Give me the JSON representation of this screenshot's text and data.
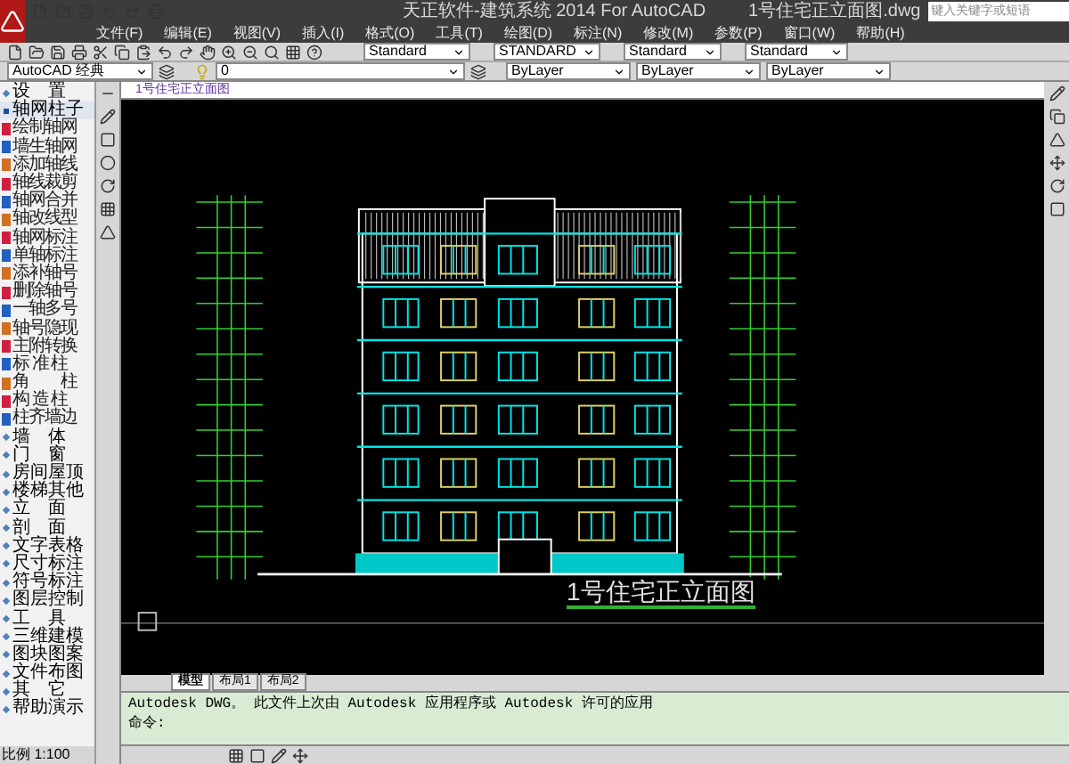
{
  "app": {
    "title": "天正软件-建筑系统 2014  For AutoCAD",
    "file_name": "1号住宅正立面图.dwg",
    "search": {
      "placeholder": "键入关键字或短语"
    }
  },
  "menu": [
    "文件(F)",
    "编辑(E)",
    "视图(V)",
    "插入(I)",
    "格式(O)",
    "工具(T)",
    "绘图(D)",
    "标注(N)",
    "修改(M)",
    "参数(P)",
    "窗口(W)",
    "帮助(H)"
  ],
  "toolbar": {
    "text_style": "Standard",
    "dim_style": "STANDARD",
    "table_style": "Standard",
    "multileader_style": "Standard",
    "workspace": "AutoCAD 经典",
    "layer": "0",
    "color_control": "ByLayer",
    "linetype": "ByLayer",
    "lineweight": "ByLayer"
  },
  "panel": {
    "sections": [
      {
        "label": "设　置",
        "expanded": false
      },
      {
        "label": "轴网柱子",
        "expanded": true,
        "children": [
          "绘制轴网",
          "墙生轴网",
          "添加轴线",
          "轴线裁剪",
          "轴网合并",
          "轴改线型",
          "轴网标注",
          "单轴标注",
          "添补轴号",
          "删除轴号",
          "一轴多号",
          "轴号隐现",
          "主附转换",
          "标 准 柱",
          "角　　柱",
          "构 造 柱",
          "柱齐墙边"
        ]
      },
      {
        "label": "墙　体",
        "expanded": false
      },
      {
        "label": "门　窗",
        "expanded": false
      },
      {
        "label": "房间屋顶",
        "expanded": false
      },
      {
        "label": "楼梯其他",
        "expanded": false
      },
      {
        "label": "立　面",
        "expanded": false
      },
      {
        "label": "剖　面",
        "expanded": false
      },
      {
        "label": "文字表格",
        "expanded": false
      },
      {
        "label": "尺寸标注",
        "expanded": false
      },
      {
        "label": "符号标注",
        "expanded": false
      },
      {
        "label": "图层控制",
        "expanded": false
      },
      {
        "label": "工　具",
        "expanded": false
      },
      {
        "label": "三维建模",
        "expanded": false
      },
      {
        "label": "图块图案",
        "expanded": false
      },
      {
        "label": "文件布图",
        "expanded": false
      },
      {
        "label": "其　它",
        "expanded": false
      },
      {
        "label": "帮助演示",
        "expanded": false
      }
    ]
  },
  "drawing": {
    "tab": "1号住宅正立面图",
    "title": "1号住宅正立面图"
  },
  "layout_tabs": [
    {
      "label": "模型",
      "selected": true
    },
    {
      "label": "布局1",
      "selected": false
    },
    {
      "label": "布局2",
      "selected": false
    }
  ],
  "command": {
    "history": "Autodesk DWG。  此文件上次由 Autodesk 应用程序或 Autodesk 许可的应用",
    "prompt": "命令:"
  },
  "status": {
    "scale": "比例 1:100"
  }
}
